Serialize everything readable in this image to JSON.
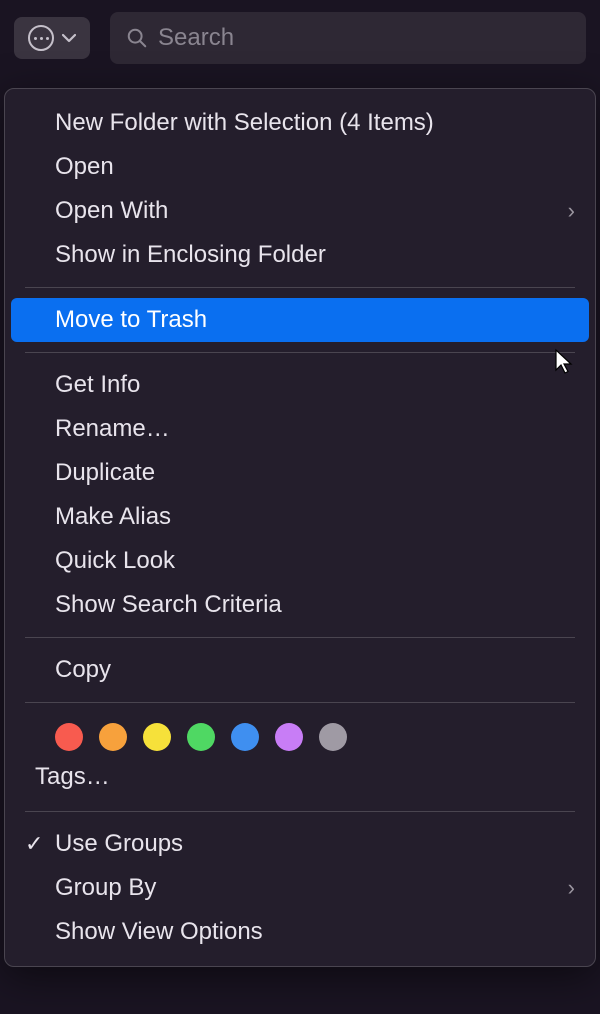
{
  "toolbar": {
    "search_placeholder": "Search"
  },
  "menu": {
    "section1": [
      {
        "label": "New Folder with Selection (4 Items)",
        "has_submenu": false
      },
      {
        "label": "Open",
        "has_submenu": false
      },
      {
        "label": "Open With",
        "has_submenu": true
      },
      {
        "label": "Show in Enclosing Folder",
        "has_submenu": false
      }
    ],
    "section2": [
      {
        "label": "Move to Trash",
        "has_submenu": false,
        "highlighted": true
      }
    ],
    "section3": [
      {
        "label": "Get Info",
        "has_submenu": false
      },
      {
        "label": "Rename…",
        "has_submenu": false
      },
      {
        "label": "Duplicate",
        "has_submenu": false
      },
      {
        "label": "Make Alias",
        "has_submenu": false
      },
      {
        "label": "Quick Look",
        "has_submenu": false
      },
      {
        "label": "Show Search Criteria",
        "has_submenu": false
      }
    ],
    "section4": [
      {
        "label": "Copy",
        "has_submenu": false
      }
    ],
    "tags": {
      "colors": [
        "#f85b4f",
        "#f7a13c",
        "#f6e13a",
        "#4fd863",
        "#3f8ff0",
        "#c87df6",
        "#9f9aa4"
      ],
      "label": "Tags…"
    },
    "section5": [
      {
        "label": "Use Groups",
        "has_submenu": false,
        "checked": true
      },
      {
        "label": "Group By",
        "has_submenu": true
      },
      {
        "label": "Show View Options",
        "has_submenu": false
      }
    ]
  }
}
